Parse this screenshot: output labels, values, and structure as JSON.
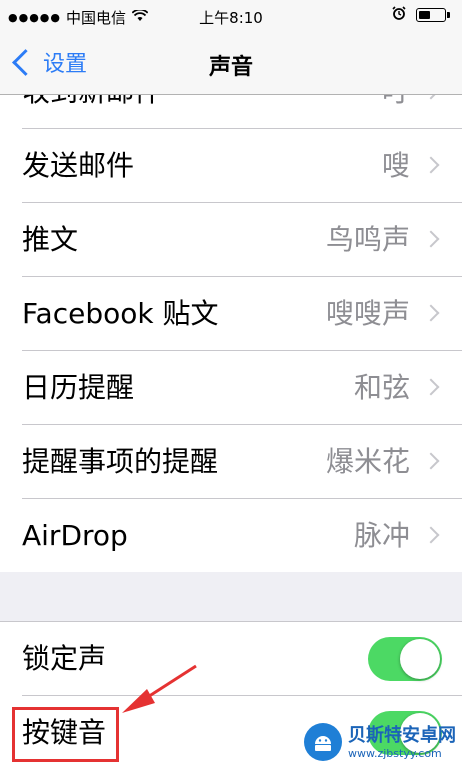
{
  "status_bar": {
    "carrier": "中国电信",
    "time": "上午8:10",
    "signal_dots": "●●●●●",
    "wifi_icon": "wifi-icon",
    "alarm_icon": "alarm-clock-icon",
    "battery_icon": "battery-icon"
  },
  "nav": {
    "back_label": "设置",
    "title": "声音"
  },
  "group1": {
    "items": [
      {
        "label": "收到新邮件",
        "value": "叮"
      },
      {
        "label": "发送邮件",
        "value": "嗖"
      },
      {
        "label": "推文",
        "value": "鸟鸣声"
      },
      {
        "label": "Facebook 贴文",
        "value": "嗖嗖声"
      },
      {
        "label": "日历提醒",
        "value": "和弦"
      },
      {
        "label": "提醒事项的提醒",
        "value": "爆米花"
      },
      {
        "label": "AirDrop",
        "value": "脉冲"
      }
    ]
  },
  "group2": {
    "items": [
      {
        "label": "锁定声",
        "on": true
      },
      {
        "label": "按键音",
        "on": true
      }
    ]
  },
  "annotation": {
    "highlight_color": "#e53232"
  },
  "watermark": {
    "title": "贝斯特安卓网",
    "url": "www.zjbstyy.com"
  },
  "colors": {
    "accent": "#2c7cf6",
    "toggle_on": "#4cd964",
    "value_gray": "#8e8e93"
  }
}
